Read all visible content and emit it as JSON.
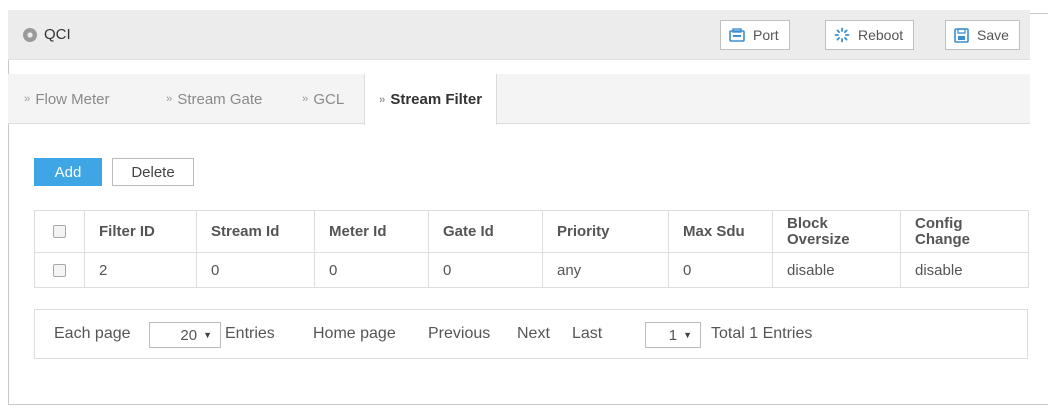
{
  "header": {
    "title": "QCI",
    "buttons": {
      "port": "Port",
      "reboot": "Reboot",
      "save": "Save"
    }
  },
  "tabs": [
    {
      "label": "Flow Meter",
      "active": false
    },
    {
      "label": "Stream Gate",
      "active": false
    },
    {
      "label": "GCL",
      "active": false
    },
    {
      "label": "Stream Filter",
      "active": true
    }
  ],
  "actions": {
    "add": "Add",
    "delete": "Delete"
  },
  "table": {
    "columns": [
      "Filter ID",
      "Stream Id",
      "Meter Id",
      "Gate Id",
      "Priority",
      "Max Sdu",
      "Block Oversize",
      "Config Change"
    ],
    "rows": [
      [
        "2",
        "0",
        "0",
        "0",
        "any",
        "0",
        "disable",
        "disable"
      ]
    ]
  },
  "pager": {
    "each_page": "Each page",
    "page_size": "20",
    "entries": "Entries",
    "home": "Home page",
    "previous": "Previous",
    "next": "Next",
    "last": "Last",
    "current_page": "1",
    "total": "Total 1 Entries"
  },
  "colors": {
    "accent": "#3fa6e6",
    "header_bg": "#ececec"
  }
}
